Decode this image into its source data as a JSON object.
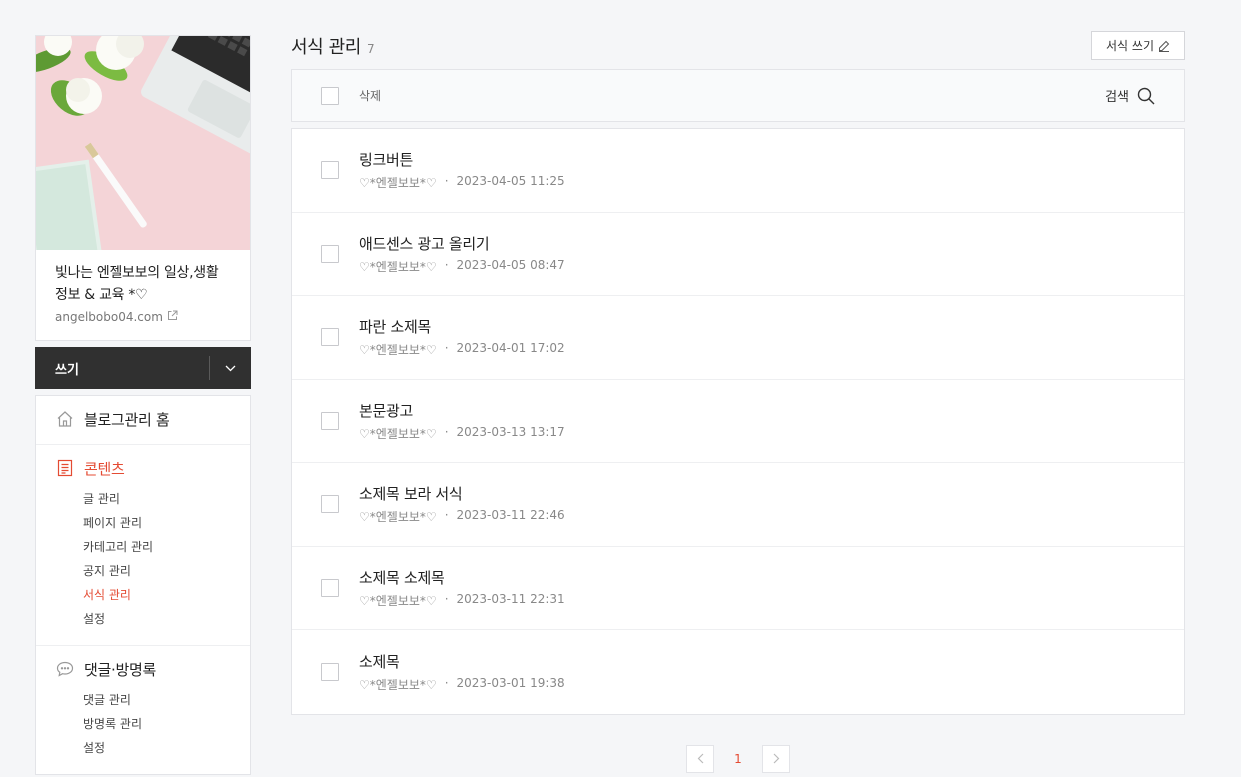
{
  "blog": {
    "title": "빛나는 엔젤보보의 일상,생활 정보 & 교육 *♡",
    "url": "angelbobo04.com"
  },
  "write": {
    "label": "쓰기"
  },
  "nav": {
    "home": {
      "label": "블로그관리 홈"
    },
    "contents": {
      "label": "콘텐츠",
      "items": [
        "글 관리",
        "페이지 관리",
        "카테고리 관리",
        "공지 관리",
        "서식 관리",
        "설정"
      ]
    },
    "comments": {
      "label": "댓글·방명록",
      "items": [
        "댓글 관리",
        "방명록 관리",
        "설정"
      ]
    }
  },
  "page": {
    "title": "서식 관리",
    "count": "7",
    "write_button": "서식 쓰기"
  },
  "toolbar": {
    "delete_label": "삭제",
    "search_label": "검색"
  },
  "templates": [
    {
      "title": "링크버튼",
      "author": "♡*엔젤보보*♡",
      "date": "2023-04-05 11:25"
    },
    {
      "title": "애드센스 광고 올리기",
      "author": "♡*엔젤보보*♡",
      "date": "2023-04-05 08:47"
    },
    {
      "title": "파란 소제목",
      "author": "♡*엔젤보보*♡",
      "date": "2023-04-01 17:02"
    },
    {
      "title": "본문광고",
      "author": "♡*엔젤보보*♡",
      "date": "2023-03-13 13:17"
    },
    {
      "title": "소제목 보라 서식",
      "author": "♡*엔젤보보*♡",
      "date": "2023-03-11 22:46"
    },
    {
      "title": "소제목 소제목",
      "author": "♡*엔젤보보*♡",
      "date": "2023-03-11 22:31"
    },
    {
      "title": "소제목",
      "author": "♡*엔젤보보*♡",
      "date": "2023-03-01 19:38"
    }
  ],
  "pagination": {
    "current": "1"
  },
  "colors": {
    "accent": "#e44b33",
    "dark_bar": "#303030",
    "background": "#f5f6f8"
  },
  "icons": {
    "home": "home-icon",
    "contents": "document-icon",
    "comments": "speech-bubble-icon",
    "search": "search-icon",
    "pencil": "pencil-icon",
    "external": "external-link-icon"
  }
}
